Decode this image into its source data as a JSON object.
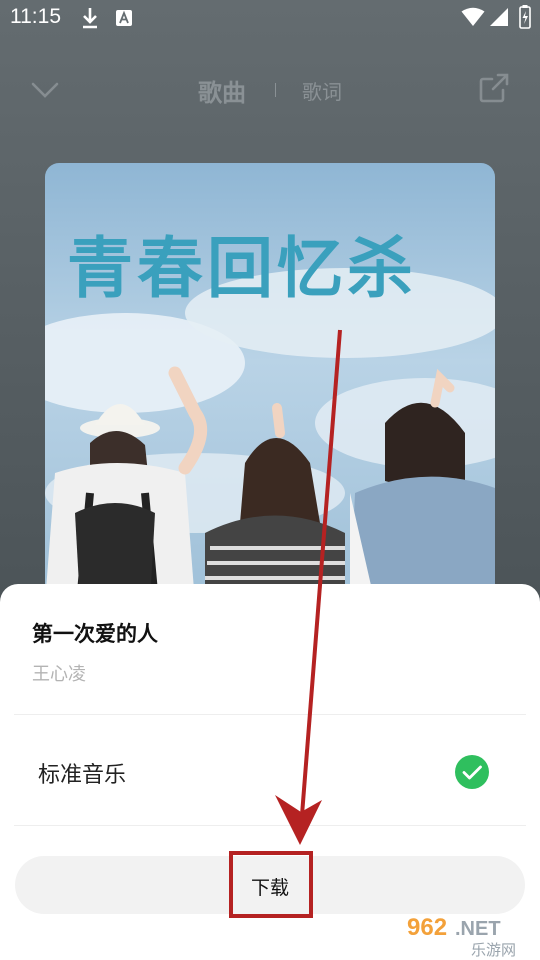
{
  "status_bar": {
    "time": "11:15"
  },
  "header": {
    "tab_song": "歌曲",
    "tab_lyrics": "歌词"
  },
  "album": {
    "cover_text": "青春回忆杀"
  },
  "sheet": {
    "song_title": "第一次爱的人",
    "artist": "王心凌",
    "quality_option": "标准音乐",
    "download_label": "下载"
  },
  "watermark": {
    "brand": "962.NET",
    "sub": "乐游网"
  },
  "colors": {
    "accent_check": "#2fbf5e",
    "highlight": "#b52222",
    "cover_text": "#3aa0bd"
  }
}
